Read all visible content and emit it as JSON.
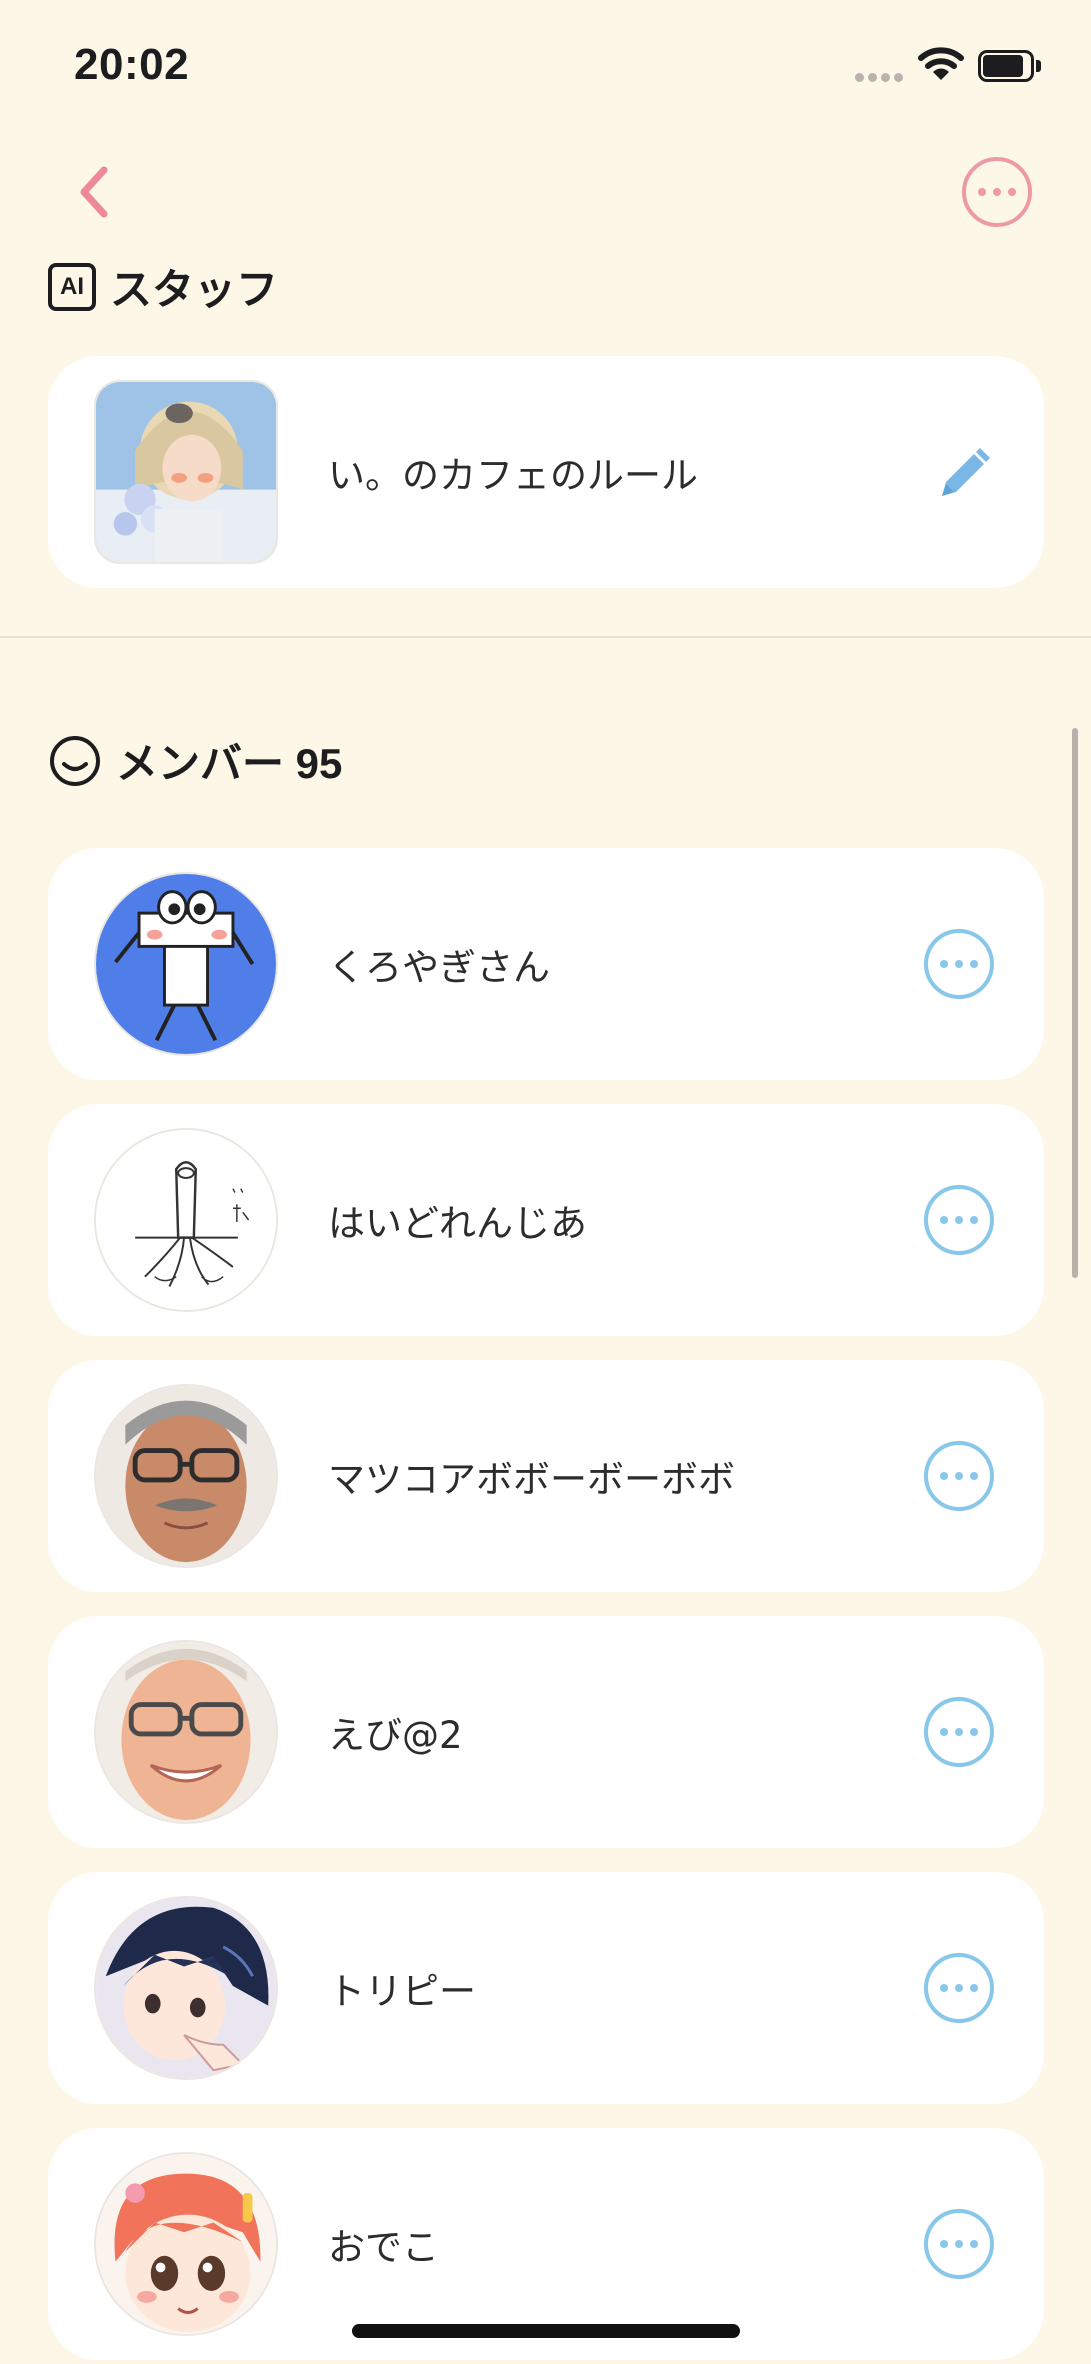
{
  "status_bar": {
    "time": "20:02"
  },
  "nav": {
    "back_icon": "chevron-left-icon",
    "more_icon": "ellipsis-circle-icon",
    "accent_color": "#ee9aa5"
  },
  "staff_section": {
    "badge": "AI",
    "title": "スタッフ",
    "items": [
      {
        "name": "い。のカフェのルール",
        "avatar": "anime-girl-with-flowers",
        "action_icon": "pencil-icon"
      }
    ]
  },
  "members_section": {
    "title": "メンバー 95",
    "icon": "smile-face-icon",
    "action_color": "#88c6ea",
    "members": [
      {
        "name": "くろやぎさん",
        "avatar": "blue-cartoon-creature"
      },
      {
        "name": "はいどれんじあ",
        "avatar": "root-sketch-drawing"
      },
      {
        "name": "マツコアボボーボーボボ",
        "avatar": "man-with-mustache-and-glasses"
      },
      {
        "name": "えび@2",
        "avatar": "smiling-man-with-glasses"
      },
      {
        "name": "トリピー",
        "avatar": "anime-boy-dark-hair"
      },
      {
        "name": "おでこ",
        "avatar": "cartoon-girl-orange-hair"
      }
    ]
  }
}
